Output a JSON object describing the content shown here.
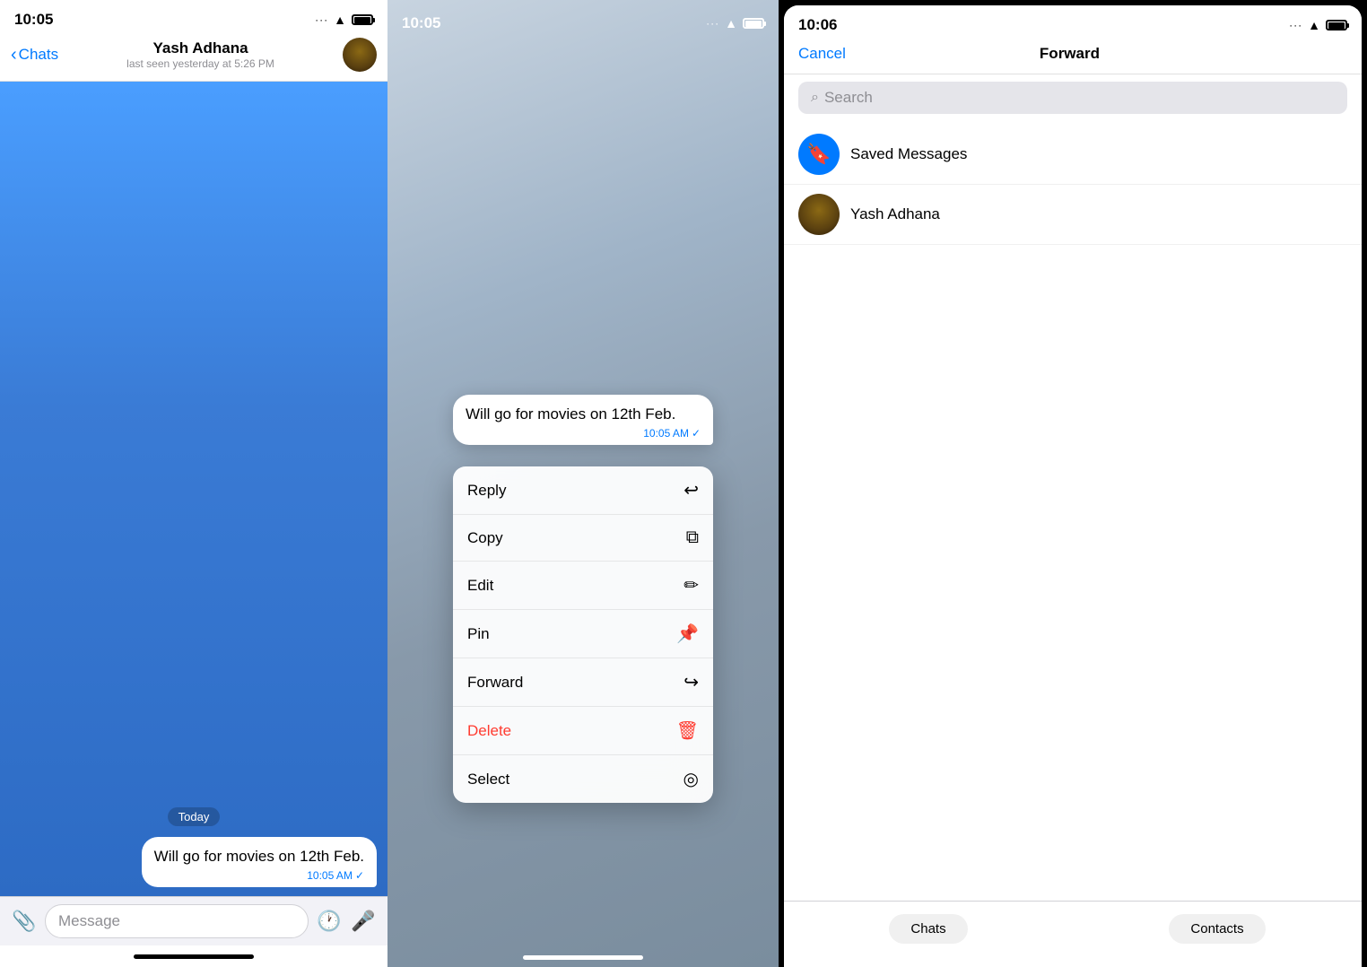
{
  "panel1": {
    "statusBar": {
      "time": "10:05"
    },
    "nav": {
      "backLabel": "Chats",
      "contactName": "Yash Adhana",
      "lastSeen": "last seen yesterday at 5:26 PM"
    },
    "chat": {
      "dateBadge": "Today",
      "message": "Will go for movies on 12th Feb.",
      "messageTime": "10:05 AM",
      "checkmark": "✓"
    },
    "inputBar": {
      "placeholder": "Message"
    }
  },
  "panel2": {
    "statusBar": {
      "time": "10:05"
    },
    "messagePreview": "Will go for movies on 12th Feb.",
    "messageTime": "10:05 AM",
    "contextMenu": [
      {
        "label": "Reply",
        "icon": "↩",
        "id": "reply"
      },
      {
        "label": "Copy",
        "icon": "⎘",
        "id": "copy"
      },
      {
        "label": "Edit",
        "icon": "✎",
        "id": "edit"
      },
      {
        "label": "Pin",
        "icon": "📌",
        "id": "pin"
      },
      {
        "label": "Forward",
        "icon": "↪",
        "id": "forward"
      },
      {
        "label": "Delete",
        "icon": "🗑",
        "id": "delete",
        "danger": true
      },
      {
        "label": "Select",
        "icon": "◎",
        "id": "select"
      }
    ]
  },
  "panel3": {
    "statusBar": {
      "time": "10:06"
    },
    "nav": {
      "cancelLabel": "Cancel",
      "title": "Forward"
    },
    "search": {
      "placeholder": "Search"
    },
    "contacts": [
      {
        "name": "Saved Messages",
        "type": "saved"
      },
      {
        "name": "Yash Adhana",
        "type": "yash"
      }
    ],
    "bottomTabs": [
      {
        "label": "Chats"
      },
      {
        "label": "Contacts"
      }
    ]
  }
}
